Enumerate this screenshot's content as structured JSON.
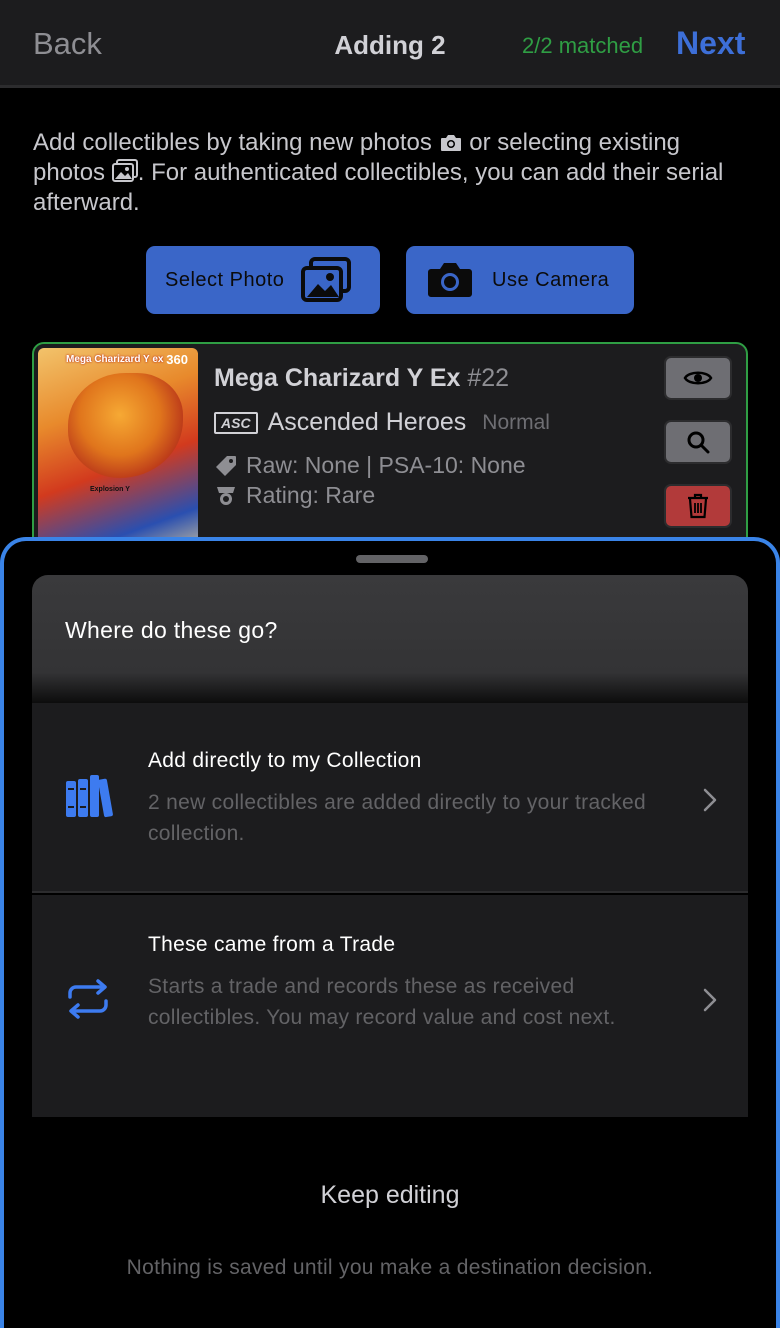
{
  "header": {
    "back_label": "Back",
    "title": "Adding 2",
    "matched_status": "2/2 matched",
    "next_label": "Next"
  },
  "instructions": {
    "part1": "Add collectibles by taking new photos",
    "part2": "or selecting existing photos",
    "part3": ". For authenticated collectibles, you can add their serial afterward."
  },
  "actions": {
    "select_photo_label": "Select Photo",
    "use_camera_label": "Use Camera"
  },
  "card": {
    "name": "Mega Charizard Y Ex",
    "number": "#22",
    "set_code": "ASC",
    "set_name": "Ascended Heroes",
    "variant": "Normal",
    "prices": "Raw: None | PSA-10: None",
    "rating": "Rating: Rare",
    "image": {
      "card_name_text": "Mega Charizard Y ex",
      "hp_text": "360",
      "attack_text": "Explosion Y"
    }
  },
  "sheet": {
    "title": "Where do these go?",
    "options": [
      {
        "title": "Add directly to my Collection",
        "description": "2 new collectibles are added directly to your tracked collection.",
        "icon": "collection-books-icon"
      },
      {
        "title": "These came from a Trade",
        "description": "Starts a trade and records these as received collectibles. You may record value and cost next.",
        "icon": "trade-arrows-icon"
      }
    ],
    "keep_editing_label": "Keep editing",
    "note": "Nothing is saved until you make a destination decision."
  },
  "colors": {
    "accent_blue": "#3a66c8",
    "next_blue": "#3d6fd8",
    "matched_green": "#2f9e44",
    "sheet_border": "#3a84e8",
    "delete_red": "#b23a3a"
  }
}
